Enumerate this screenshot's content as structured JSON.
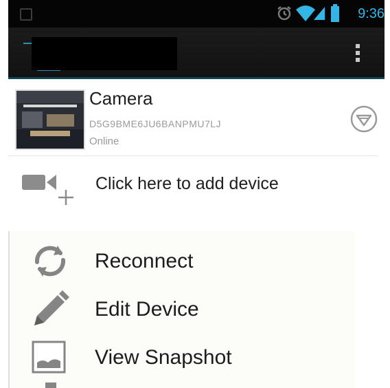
{
  "status_bar": {
    "time": "9:36",
    "icons": [
      "notification-icon",
      "alarm-icon",
      "wifi-icon",
      "signal-icon",
      "battery-icon"
    ],
    "accent_color": "#33b5e5"
  },
  "action_bar": {
    "icons": [
      "app-icon",
      "overflow-menu-icon"
    ]
  },
  "device": {
    "name": "Camera",
    "uid": "D5G9BME6JU6BANPMU7LJ",
    "status": "Online",
    "status_icon": "online-status-icon"
  },
  "add_device": {
    "label": "Click here to add device",
    "icon": "add-video-camera-icon"
  },
  "context_menu": {
    "items": [
      {
        "label": "Reconnect",
        "icon": "refresh-icon"
      },
      {
        "label": "Edit Device",
        "icon": "pencil-icon"
      },
      {
        "label": "View Snapshot",
        "icon": "image-icon"
      }
    ]
  }
}
